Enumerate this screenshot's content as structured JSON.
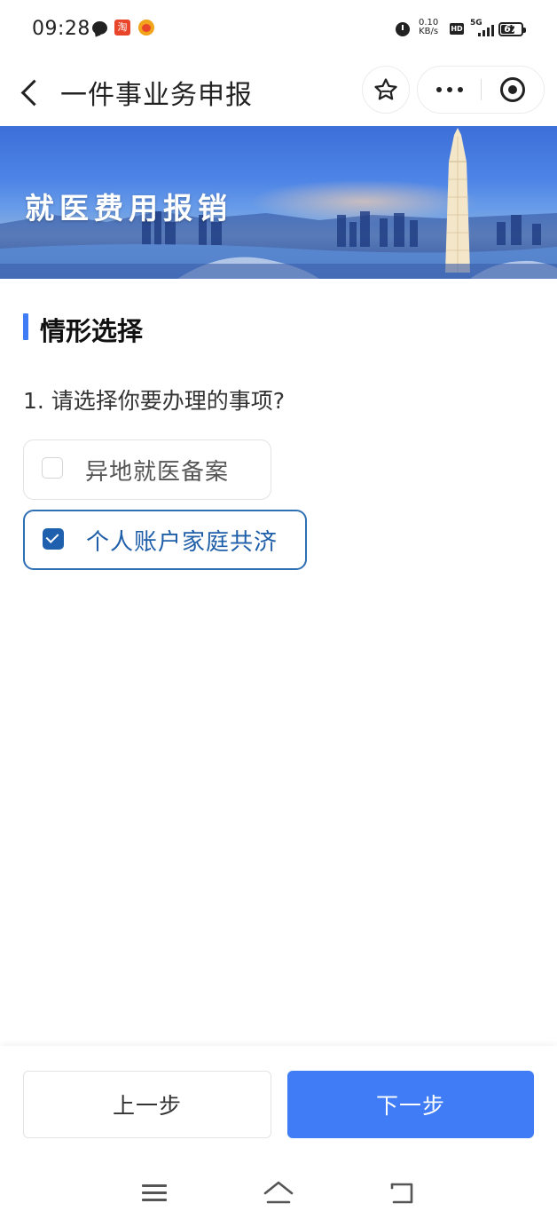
{
  "status_bar": {
    "time": "09:28",
    "taobao_icon_text": "淘",
    "net_speed_value": "0.10",
    "net_speed_unit": "KB/s",
    "hd_label": "HD",
    "signal_label": "5G",
    "battery_level": "67"
  },
  "nav": {
    "title": "一件事业务申报",
    "icons": [
      "back-arrow-icon",
      "star-icon",
      "more-dots-icon",
      "close-target-icon"
    ]
  },
  "banner": {
    "title": "就医费用报销"
  },
  "section": {
    "title": "情形选择"
  },
  "question": {
    "text": "1. 请选择你要办理的事项?"
  },
  "options": [
    {
      "label": "异地就医备案",
      "checked": false
    },
    {
      "label": "个人账户家庭共济",
      "checked": true
    }
  ],
  "footer": {
    "prev_label": "上一步",
    "next_label": "下一步"
  },
  "colors": {
    "accent": "#3f7cf5",
    "selected_border": "#2f6fb4",
    "selected_text": "#1f5ea8"
  },
  "system_nav": {
    "icons": [
      "menu-icon",
      "home-icon",
      "back-icon"
    ]
  }
}
